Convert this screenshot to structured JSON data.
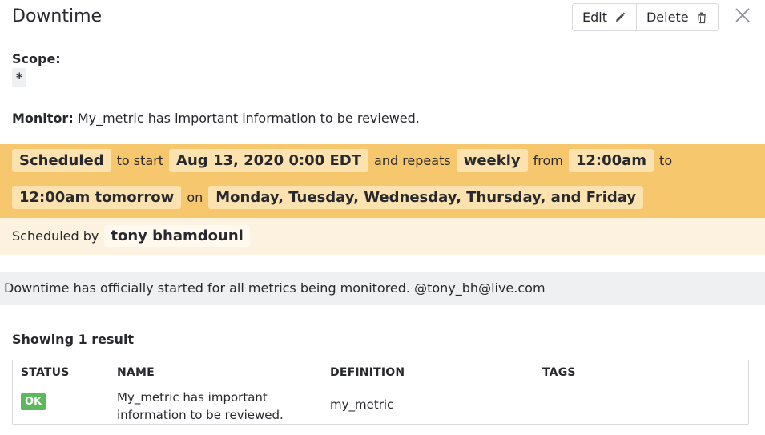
{
  "header": {
    "title": "Downtime",
    "edit_label": "Edit",
    "delete_label": "Delete"
  },
  "scope": {
    "label": "Scope:",
    "value": "*"
  },
  "monitor": {
    "label": "Monitor:",
    "text": "My_metric has important information to be reviewed."
  },
  "schedule": {
    "status": "Scheduled",
    "to_start_word": "to start",
    "start": "Aug 13, 2020 0:00 EDT",
    "and_repeats_word": "and repeats",
    "frequency": "weekly",
    "from_word": "from",
    "from_time": "12:00am",
    "to_word": "to",
    "to_time": "12:00am tomorrow",
    "on_word": "on",
    "days": "Monday, Tuesday, Wednesday, Thursday, and Friday",
    "scheduled_by_label": "Scheduled by",
    "scheduled_by": "tony bhamdouni"
  },
  "message": "Downtime has officially started for all metrics being monitored. @tony_bh@live.com",
  "results": {
    "showing": "Showing 1 result",
    "columns": [
      "STATUS",
      "NAME",
      "DEFINITION",
      "TAGS"
    ],
    "rows": [
      {
        "status": "OK",
        "name_line1": "My_metric has important",
        "name_line2": "information to be reviewed.",
        "definition": "my_metric",
        "tags": ""
      }
    ]
  },
  "colors": {
    "schedule_band": "#f7c76e",
    "schedule_chip": "#fbe2ae",
    "scheduled_by_band": "#fdf2e0",
    "message_band": "#eef0f2",
    "ok_badge": "#5cb85c"
  },
  "icons": {
    "edit": "pencil-icon",
    "delete": "trash-icon",
    "close": "close-icon"
  }
}
